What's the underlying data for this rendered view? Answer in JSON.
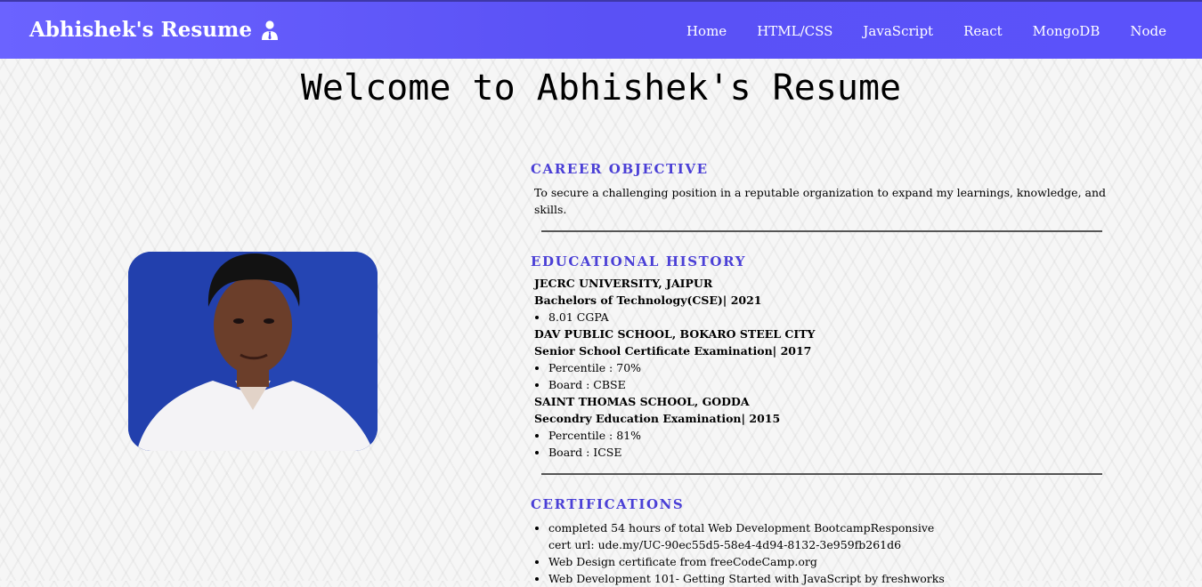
{
  "navbar": {
    "brand": "Abhishek's Resume",
    "brand_icon": "user-tie-icon",
    "links": [
      "Home",
      "HTML/CSS",
      "JavaScript",
      "React",
      "MongoDB",
      "Node"
    ]
  },
  "page_title": "Welcome to Abhishek's Resume",
  "career": {
    "title": "CAREER OBJECTIVE",
    "text": "To secure a challenging position in a reputable organization to expand my learnings, knowledge, and skills."
  },
  "education": {
    "title": "EDUCATIONAL HISTORY",
    "entries": [
      {
        "school": "JECRC UNIVERSITY, JAIPUR",
        "degree": "Bachelors of Technology(CSE)| 2021",
        "details": [
          "8.01 CGPA"
        ]
      },
      {
        "school": "DAV PUBLIC SCHOOL, BOKARO STEEL CITY",
        "degree": "Senior School Certificate Examination| 2017",
        "details": [
          "Percentile : 70%",
          "Board : CBSE"
        ]
      },
      {
        "school": "SAINT THOMAS SCHOOL, GODDA",
        "degree": "Secondry Education Examination| 2015",
        "details": [
          "Percentile : 81%",
          "Board : ICSE"
        ]
      }
    ]
  },
  "certifications": {
    "title": "CERTIFICATIONS",
    "items": [
      "completed 54 hours of total Web Development BootcampResponsive",
      "cert url: ude.my/UC-90ec55d5-58e4-4d94-8132-3e959fb261d6",
      "Web Design certificate from freeCodeCamp.org",
      "Web Development 101- Getting Started with JavaScript by freshworks"
    ]
  },
  "colors": {
    "nav": "#5a51f5",
    "section_title": "#4a3fd6"
  }
}
